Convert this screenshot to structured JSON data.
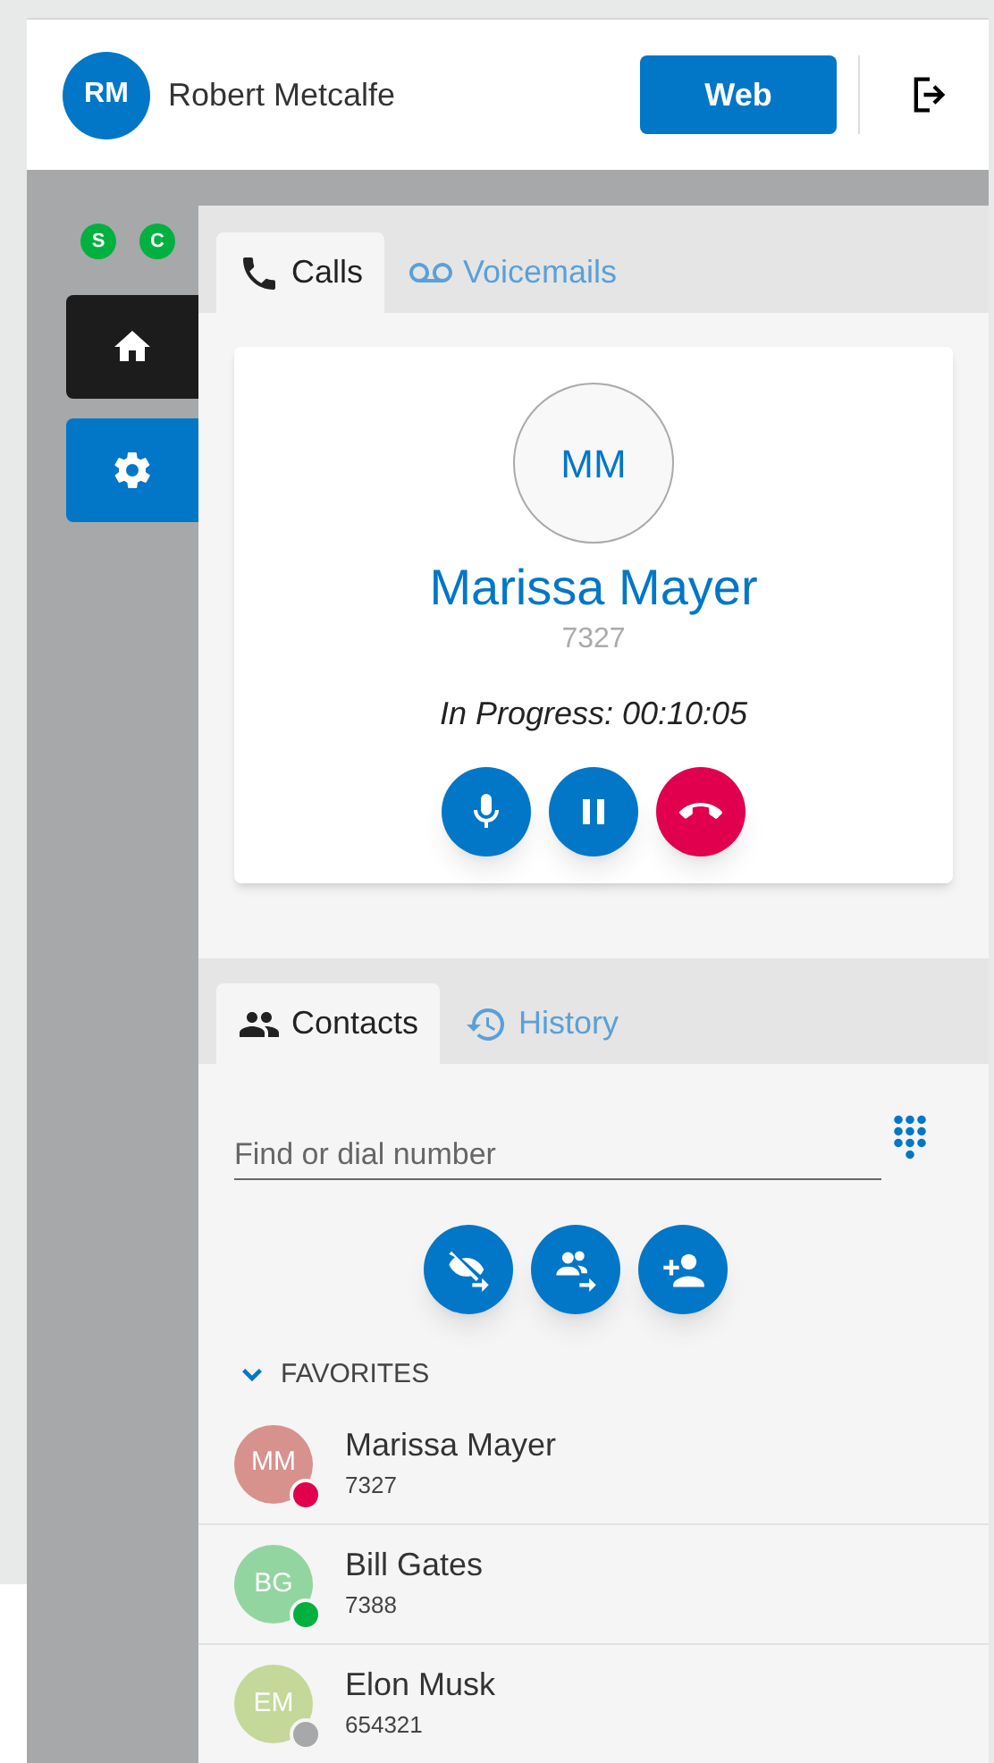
{
  "header": {
    "avatar": "RM",
    "user_name": "Robert Metcalfe",
    "mode_button": "Web"
  },
  "sidebar": {
    "status_badges": [
      {
        "label": "S",
        "color": "#00b140"
      },
      {
        "label": "C",
        "color": "#00b140"
      }
    ],
    "nav_items": [
      {
        "kind": "home"
      },
      {
        "kind": "settings"
      }
    ]
  },
  "call_tabs": [
    {
      "label": "Calls",
      "kind": "calls",
      "selected": true
    },
    {
      "label": "Voicemails",
      "kind": "voicemail",
      "selected": false
    }
  ],
  "active_call": {
    "avatar": "MM",
    "name": "Marissa Mayer",
    "number": "7327",
    "status": "In Progress: 00:10:05",
    "actions": [
      {
        "kind": "mute"
      },
      {
        "kind": "hold"
      },
      {
        "kind": "hangup"
      }
    ]
  },
  "contact_tabs": [
    {
      "label": "Contacts",
      "kind": "contacts",
      "selected": true
    },
    {
      "label": "History",
      "kind": "history",
      "selected": false
    }
  ],
  "search": {
    "placeholder": "Find or dial number"
  },
  "contact_actions": [
    {
      "kind": "hidden-transfer"
    },
    {
      "kind": "group-transfer"
    },
    {
      "kind": "add-contact"
    }
  ],
  "favorites": {
    "label": "FAVORITES",
    "expanded": true,
    "contacts": [
      {
        "avatar": {
          "initials": "MM",
          "color": "#d7928d"
        },
        "name": "Marissa Mayer",
        "number": "7327",
        "presence": {
          "color": "#e0004d"
        }
      },
      {
        "avatar": {
          "initials": "BG",
          "color": "#93d5a0"
        },
        "name": "Bill Gates",
        "number": "7388",
        "presence": {
          "color": "#00b140"
        }
      },
      {
        "avatar": {
          "initials": "EM",
          "color": "#c4d89a"
        },
        "name": "Elon Musk",
        "number": "654321",
        "presence": {
          "color": "#a7a8aa"
        }
      }
    ]
  }
}
